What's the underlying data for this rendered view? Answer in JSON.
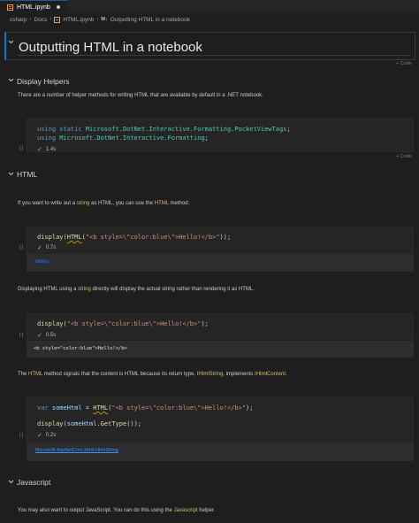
{
  "tab": {
    "name": "HTML.ipynb",
    "modified_indicator": "dot"
  },
  "breadcrumb": {
    "items": [
      "csharp",
      "Docs",
      "HTML.ipynb"
    ],
    "md_badge": "M↓",
    "section": "Outputting HTML in a notebook"
  },
  "title": "Outputting HTML in a notebook",
  "add_code_label": "+ Code",
  "sections": {
    "display_helpers": {
      "heading": "Display Helpers",
      "para": "There are a number of helper methods for writing HTML that are available by default in a .NET notebook."
    },
    "html": {
      "heading": "HTML",
      "para1_a": "If you want to write out a ",
      "para1_b": "string",
      "para1_c": " as HTML, you can use the ",
      "para1_d": "HTML",
      "para1_e": " method:",
      "para2_a": "Displaying HTML using a ",
      "para2_b": "string",
      "para2_c": " directly will display the actual string rather than rendering it as HTML.",
      "para3_a": "The ",
      "para3_b": "HTML",
      "para3_c": " method signals that the content is HTML because its return type, ",
      "para3_d": "IHtmlString",
      "para3_e": ", implements ",
      "para3_f": "IHtmlContent",
      "para3_g": "."
    },
    "javascript": {
      "heading": "Javascript",
      "para_a": "You may also want to output JavaScript. You can do this using the ",
      "para_b": "Javascript",
      "para_c": " helper."
    }
  },
  "cells": [
    {
      "exec_label": "[ ]",
      "time": "1.4s",
      "lines": {
        "l1_kw1": "using",
        "l1_kw2": " static ",
        "l1_ns": "Microsoft.DotNet.Interactive.Formatting.PocketViewTags",
        "l1_end": ";",
        "l2_kw1": "using",
        "l2_ns": " Microsoft.DotNet.Interactive.Formatting",
        "l2_end": ";"
      }
    },
    {
      "exec_label": "[ ]",
      "time": "0.7s",
      "code": {
        "fn": "display",
        "p1": "(",
        "fn2": "HTML",
        "p2": "(",
        "str": "\"<b style=\\\"color:blue\\\">Hello!</b>\"",
        "end": "));"
      },
      "output": "Hello!"
    },
    {
      "exec_label": "[ ]",
      "time": "0.5s",
      "code": {
        "fn": "display",
        "p1": "(",
        "str": "\"<b style=\\\"color:blue\\\">Hello!</b>\"",
        "end": ");"
      },
      "output": "<b style=\"color:blue\">Hello!</b>"
    },
    {
      "exec_label": "[ ]",
      "time": "0.2s",
      "code": {
        "l1_kw": "var",
        "l1_var": " someHtml",
        "l1_eq": " = ",
        "l1_fn": "HTML",
        "l1_p": "(",
        "l1_str": "\"<b style=\\\"color:blue\\\">Hello!</b>\"",
        "l1_end": ");",
        "l2_fn": "display",
        "l2_p": "(",
        "l2_var": "someHtml",
        "l2_dot": ".",
        "l2_fn2": "GetType",
        "l2_end": "());"
      },
      "output": "Microsoft.AspNetCore.Html.HtmlString"
    }
  ],
  "colors": {
    "background": "#1e1e1e",
    "accent": "#007acc",
    "keyword": "#569cd6",
    "type": "#4ec9b0",
    "function": "#dcdcaa",
    "string": "#ce9178",
    "success": "#89d185"
  }
}
